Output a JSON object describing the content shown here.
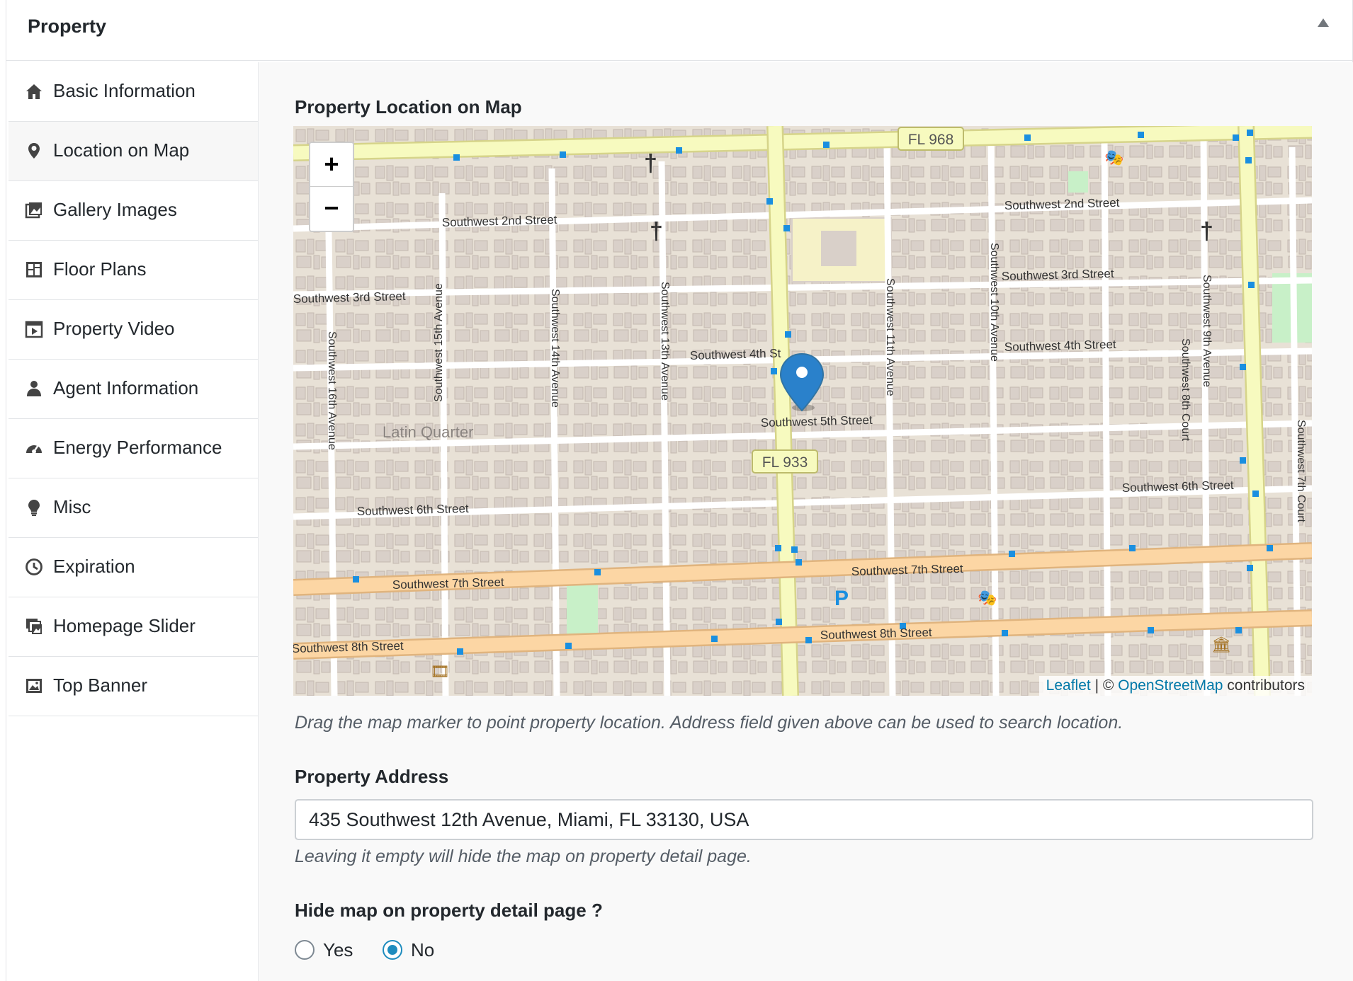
{
  "metabox": {
    "title": "Property",
    "toggle_icon": "triangle-up-icon"
  },
  "tabs": [
    {
      "label": "Basic Information",
      "icon": "home-icon"
    },
    {
      "label": "Location on Map",
      "icon": "map-pin-icon"
    },
    {
      "label": "Gallery Images",
      "icon": "gallery-icon"
    },
    {
      "label": "Floor Plans",
      "icon": "floor-plan-icon"
    },
    {
      "label": "Property Video",
      "icon": "video-icon"
    },
    {
      "label": "Agent Information",
      "icon": "agent-icon"
    },
    {
      "label": "Energy Performance",
      "icon": "dashboard-icon"
    },
    {
      "label": "Misc",
      "icon": "lightbulb-icon"
    },
    {
      "label": "Expiration",
      "icon": "clock-icon"
    },
    {
      "label": "Homepage Slider",
      "icon": "slides-icon"
    },
    {
      "label": "Top Banner",
      "icon": "image-icon"
    }
  ],
  "active_tab": "Location on Map",
  "location": {
    "map_label": "Property Location on Map",
    "zoom_in": "+",
    "zoom_out": "−",
    "attribution": {
      "leaflet": "Leaflet",
      "sep": " | © ",
      "osm": "OpenStreetMap",
      "suffix": " contributors"
    },
    "map_streets": {
      "fl968": "FL 968",
      "fl933": "FL 933",
      "sw2nd_a": "Southwest 2nd Street",
      "sw2nd_b": "Southwest 2nd Street",
      "sw3rd_a": "Southwest 3rd Street",
      "sw3rd_b": "Southwest 3rd Street",
      "sw4th_a": "Southwest 4th St",
      "sw4th_b": "Southwest 4th Street",
      "sw5th": "Southwest 5th Street",
      "sw6th_a": "Southwest 6th Street",
      "sw6th_b": "Southwest 6th Street",
      "sw7th_a": "Southwest 7th Street",
      "sw7th_b": "Southwest 7th Street",
      "sw8th_a": "Southwest 8th Street",
      "sw8th_b": "Southwest 8th Street",
      "latin_quarter": "Latin Quarter",
      "sw16av": "Southwest 16th Avenue",
      "sw15av": "Southwest 15th Avenue",
      "sw14av": "Southwest 14th Avenue",
      "sw13av": "Southwest 13th Avenue",
      "sw11av": "Southwest 11th Avenue",
      "sw10av": "Southwest 10th Avenue",
      "sw9av": "Southwest 9th Avenue",
      "sw8ct": "Southwest 8th Court",
      "sw7ct": "Southwest 7th Court"
    },
    "map_hint": "Drag the map marker to point property location. Address field given above can be used to search location.",
    "address_label": "Property Address",
    "address_value": "435 Southwest 12th Avenue, Miami, FL 33130, USA",
    "address_hint": "Leaving it empty will hide the map on property detail page.",
    "hide_map_label": "Hide map on property detail page ?",
    "hide_map_options": [
      "Yes",
      "No"
    ],
    "hide_map_selected": "No"
  },
  "colors": {
    "map_bg": "#e8e1d6",
    "major_road": "#f7fabf",
    "primary_road": "#fcd6a4",
    "marker": "#2a81cb",
    "radio_checked": "#1e8cbe"
  }
}
